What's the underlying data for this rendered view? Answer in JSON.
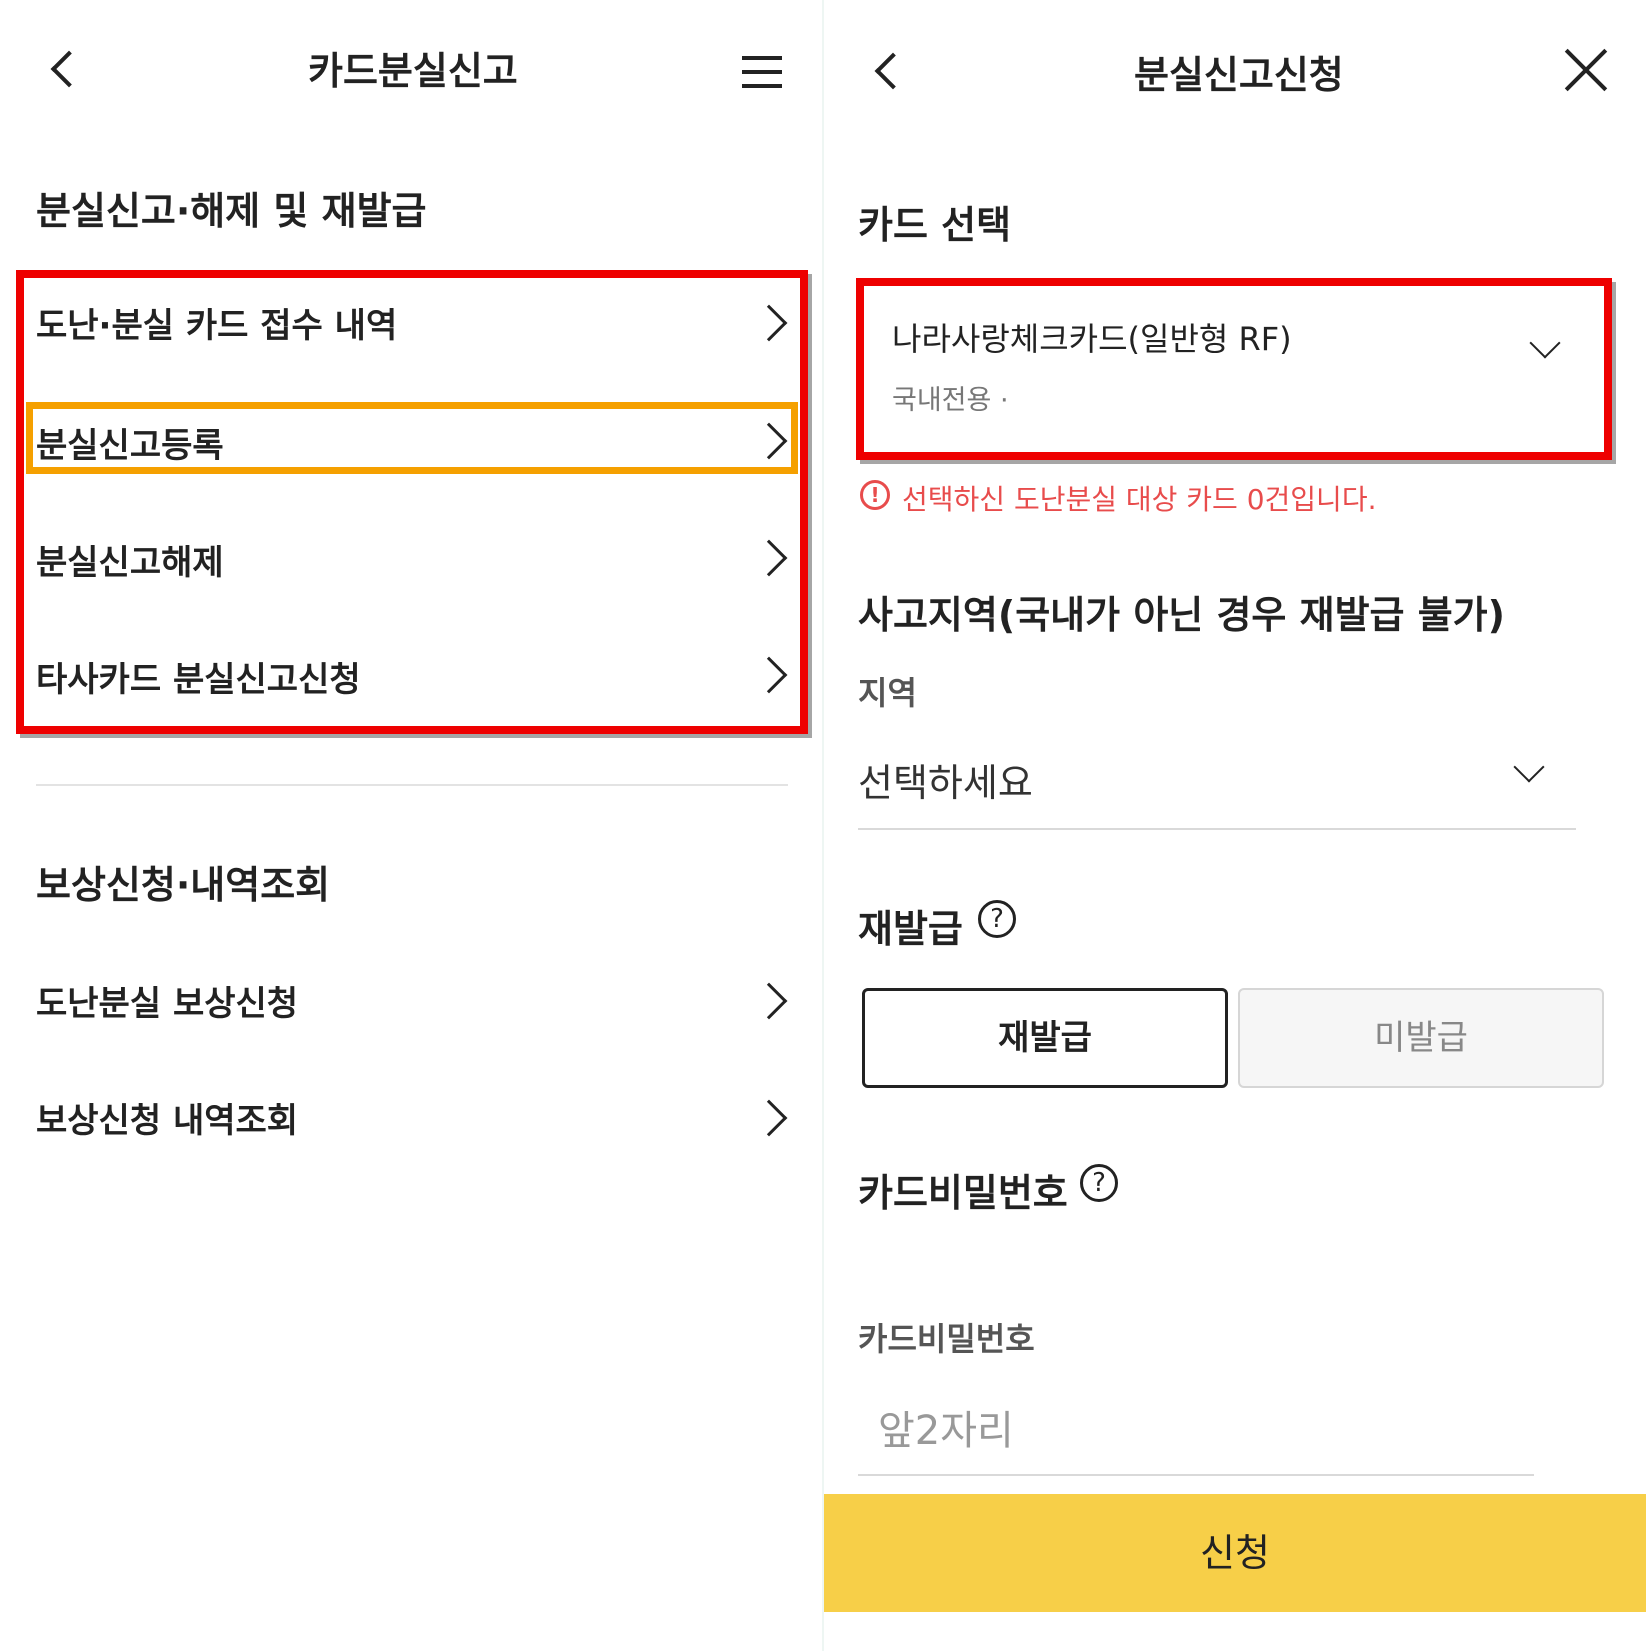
{
  "left": {
    "header": {
      "title": "카드분실신고"
    },
    "section1": {
      "title": "분실신고·해제 및 재발급",
      "items": [
        {
          "label": "도난·분실 카드 접수 내역"
        },
        {
          "label": "분실신고등록"
        },
        {
          "label": "분실신고해제"
        },
        {
          "label": "타사카드 분실신고신청"
        }
      ]
    },
    "section2": {
      "title": "보상신청·내역조회",
      "items": [
        {
          "label": "도난분실 보상신청"
        },
        {
          "label": "보상신청 내역조회"
        }
      ]
    }
  },
  "right": {
    "header": {
      "title": "분실신고신청"
    },
    "card_select": {
      "title": "카드 선택",
      "card_name": "나라사랑체크카드(일반형 RF)",
      "card_sub": "국내전용 ·",
      "warning": "선택하신 도난분실 대상 카드 0건입니다."
    },
    "accident_region": {
      "title": "사고지역(국내가 아닌 경우 재발급 불가)",
      "field_label": "지역",
      "select_value": "선택하세요"
    },
    "reissue": {
      "title": "재발급",
      "options": [
        "재발급",
        "미발급"
      ],
      "selected": "재발급"
    },
    "password": {
      "title": "카드비밀번호",
      "field_label": "카드비밀번호",
      "placeholder": "앞2자리"
    },
    "submit_label": "신청"
  },
  "colors": {
    "highlight_red": "#ee0000",
    "highlight_orange": "#f5a000",
    "submit_yellow": "#f7cf48",
    "warning_red": "#e84c4c"
  }
}
